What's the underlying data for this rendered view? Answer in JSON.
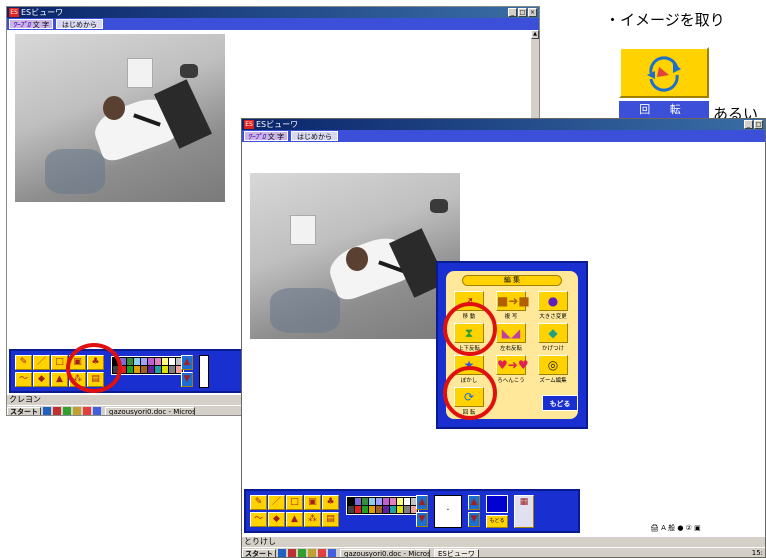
{
  "note": {
    "line1": "・イメージを取り",
    "line2": "あるい"
  },
  "rotate_button": {
    "label": "回 転"
  },
  "window_back": {
    "title": "ESビューワ",
    "menu_left": "ﾜｰﾌﾟﾛ 文 字",
    "menu_right": "はじめから",
    "status": "クレヨン"
  },
  "window_front": {
    "title": "ESビューワ",
    "menu_left": "ﾜｰﾌﾟﾛ 文 字",
    "menu_right": "はじめから",
    "status": "とりけし",
    "back_small_label": "もどる"
  },
  "edit_dialog": {
    "title": "編 集",
    "items": [
      {
        "label": "移 動",
        "icon": "move-icon"
      },
      {
        "label": "複 写",
        "icon": "copy-icon"
      },
      {
        "label": "大きさ変更",
        "icon": "resize-icon"
      },
      {
        "label": "上下反転",
        "icon": "flip-vertical-icon"
      },
      {
        "label": "左右反転",
        "icon": "flip-horizontal-icon"
      },
      {
        "label": "かげつけ",
        "icon": "shadow-icon"
      },
      {
        "label": "ぼかし",
        "icon": "blur-icon"
      },
      {
        "label": "ろへんこう",
        "icon": "color-change-icon"
      },
      {
        "label": "ズーム編集",
        "icon": "zoom-edit-icon"
      },
      {
        "label": "回 転",
        "icon": "rotate-icon"
      }
    ],
    "back_label": "もどる"
  },
  "taskbar_back": {
    "start": "スタート",
    "item": "gazousyori0.doc - Micros..."
  },
  "taskbar_front": {
    "start": "スタート",
    "item1": "gazousyori0.doc - Micros...",
    "item2": "ESビューワ",
    "clock": "15:"
  },
  "colors": {
    "accent_red": "#e01010",
    "toolbar_blue": "#1a2fd0",
    "button_yellow": "#ffd200"
  }
}
